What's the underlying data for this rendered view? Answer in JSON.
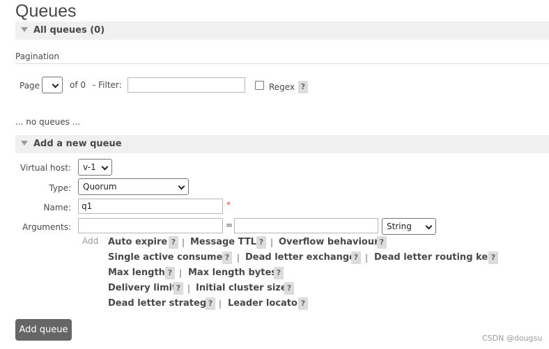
{
  "page": {
    "title": "Queues"
  },
  "all_queues": {
    "header": "All queues (0)"
  },
  "pagination": {
    "section_label": "Pagination",
    "page_label": "Page",
    "page_value": "",
    "of_label": "of 0",
    "filter_label": "- Filter:",
    "filter_value": "",
    "regex_label": "Regex",
    "help": "?"
  },
  "empty_text": "... no queues ...",
  "add_queue": {
    "header": "Add a new queue",
    "vhost_label": "Virtual host:",
    "vhost_value": "v-1",
    "type_label": "Type:",
    "type_value": "Quorum",
    "name_label": "Name:",
    "name_value": "q1",
    "required_mark": "*",
    "args_label": "Arguments:",
    "args_equals": "=",
    "args_type_value": "String",
    "add_link": "Add",
    "arg_links": [
      "Auto expire",
      "Message TTL",
      "Overflow behaviour",
      "Single active consumer",
      "Dead letter exchange",
      "Dead letter routing key",
      "Max length",
      "Max length bytes",
      "Delivery limit",
      "Initial cluster size",
      "Dead letter strategy",
      "Leader locator"
    ],
    "separator": "|",
    "submit_label": "Add queue"
  },
  "watermark": "CSDN @dougsu"
}
